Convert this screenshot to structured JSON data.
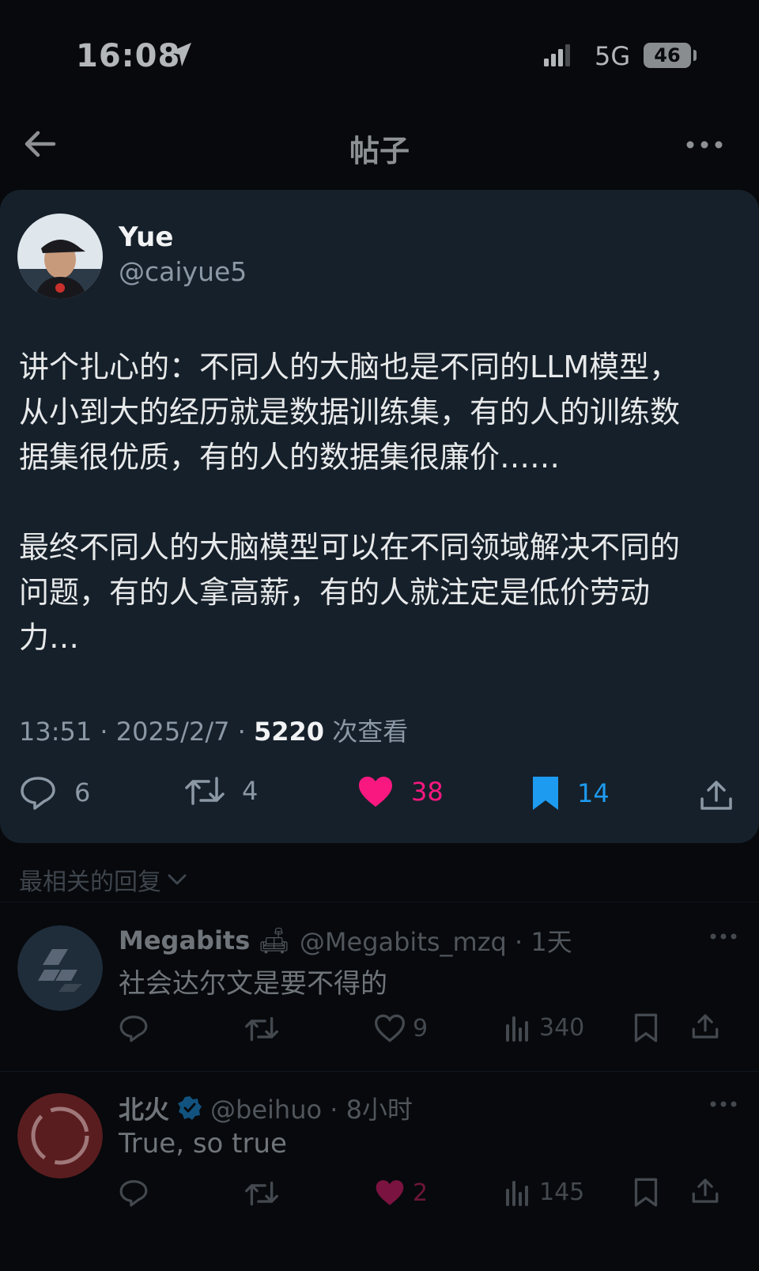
{
  "status_bar": {
    "time": "16:08",
    "network": "5G",
    "battery": "46"
  },
  "nav": {
    "title": "帖子"
  },
  "tweet": {
    "author_name": "Yue",
    "author_handle": "@caiyue5",
    "text": "讲个扎心的：不同人的大脑也是不同的LLM模型，\n从小到大的经历就是数据训练集，有的人的训练数\n据集很优质，有的人的数据集很廉价……\n\n最终不同人的大脑模型可以在不同领域解决不同的\n问题，有的人拿高薪，有的人就注定是低价劳动\n力…",
    "time_date": "13:51 · 2025/2/7 · ",
    "views": "5220",
    "views_label": " 次查看",
    "replies": "6",
    "retweets": "4",
    "likes": "38",
    "bookmarks": "14",
    "colors": {
      "like": "#f91880",
      "bookmark": "#1d9bf0"
    }
  },
  "sort": {
    "label": "最相关的回复"
  },
  "replies": [
    {
      "name": "Megabits",
      "emoji": "🛋",
      "handle_time": "@Megabits_mzq · 1天",
      "text": "社会达尔文是要不得的",
      "likes": "9",
      "views": "340"
    },
    {
      "name": "北火",
      "verified": true,
      "handle_time": "@beihuo · 8小时",
      "text": "True, so true",
      "likes": "2",
      "views": "145"
    }
  ]
}
